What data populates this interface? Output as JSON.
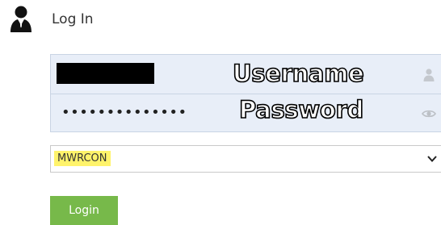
{
  "header": {
    "icon": "user-icon",
    "title": "Log In"
  },
  "credentials": {
    "username": {
      "value_redacted": true,
      "overlay_label": "Username",
      "icon": "person-icon"
    },
    "password": {
      "masked_value": "••••••••••••••",
      "overlay_label": "Password",
      "icon": "eye-icon"
    },
    "background_color": "#e8eef8"
  },
  "connection_select": {
    "selected": "MWRCON",
    "highlight_color": "#fff36b",
    "icon": "chevron-down-icon"
  },
  "login_button": {
    "label": "Login",
    "color": "#77b94a"
  }
}
